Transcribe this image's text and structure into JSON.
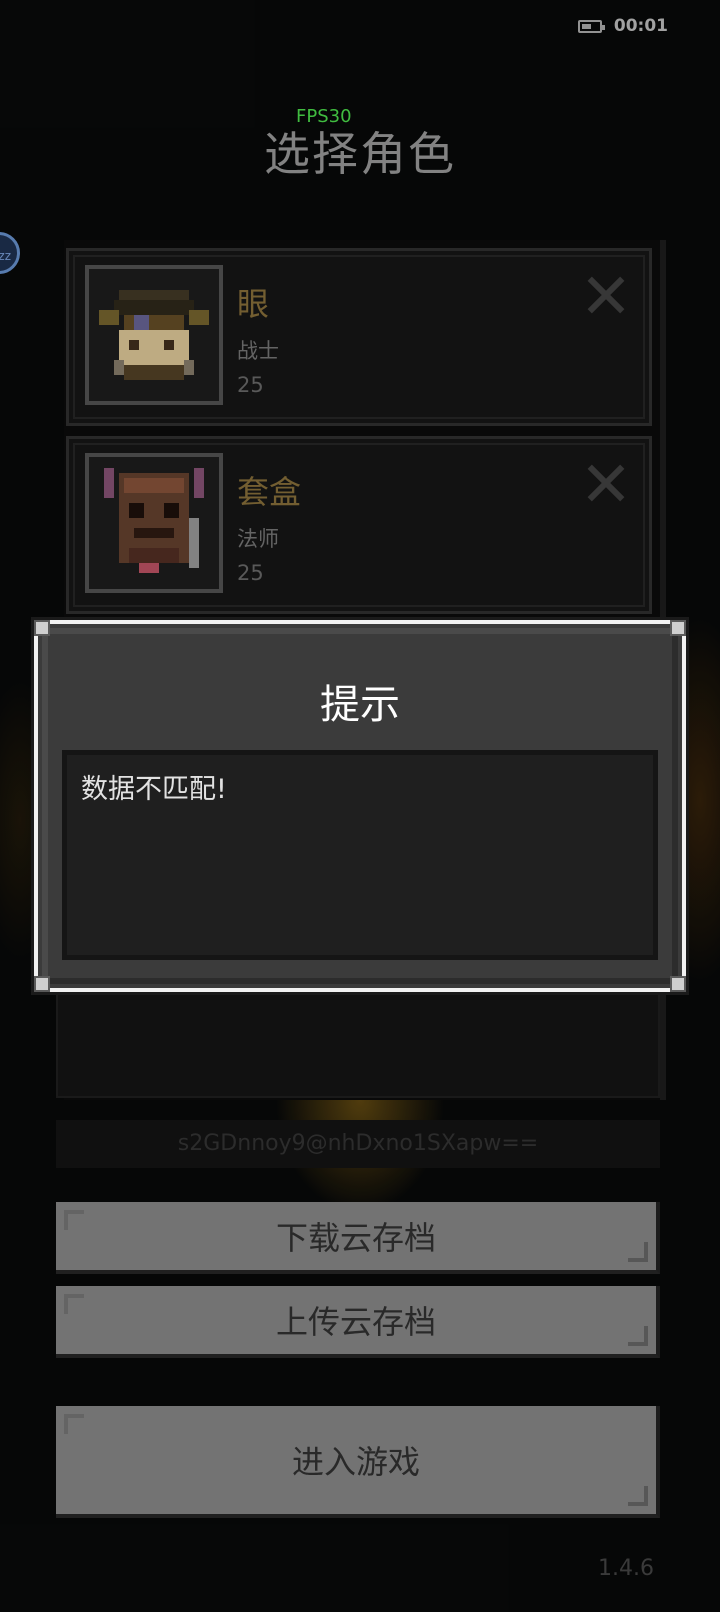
{
  "status": {
    "time": "00:01",
    "battery_icon": "battery-icon"
  },
  "fps_label": "FPS30",
  "page_title": "选择角色",
  "characters": [
    {
      "name": "眼",
      "class": "战士",
      "level": "25",
      "delete_icon": "close-icon"
    },
    {
      "name": "套盒",
      "class": "法师",
      "level": "25",
      "delete_icon": "close-icon"
    }
  ],
  "side_bubble_text": "zz",
  "save_code": "s2GDnnoy9@nhDxno1SXapw==",
  "buttons": {
    "download": "下载云存档",
    "upload": "上传云存档",
    "enter": "进入游戏"
  },
  "version": "1.4.6",
  "dialog": {
    "title": "提示",
    "message": "数据不匹配!"
  },
  "colors": {
    "background": "#070808",
    "fps": "#44c744",
    "name": "#7a6434",
    "button": "#7a7a7a",
    "dialog": "#3b3b3b"
  }
}
